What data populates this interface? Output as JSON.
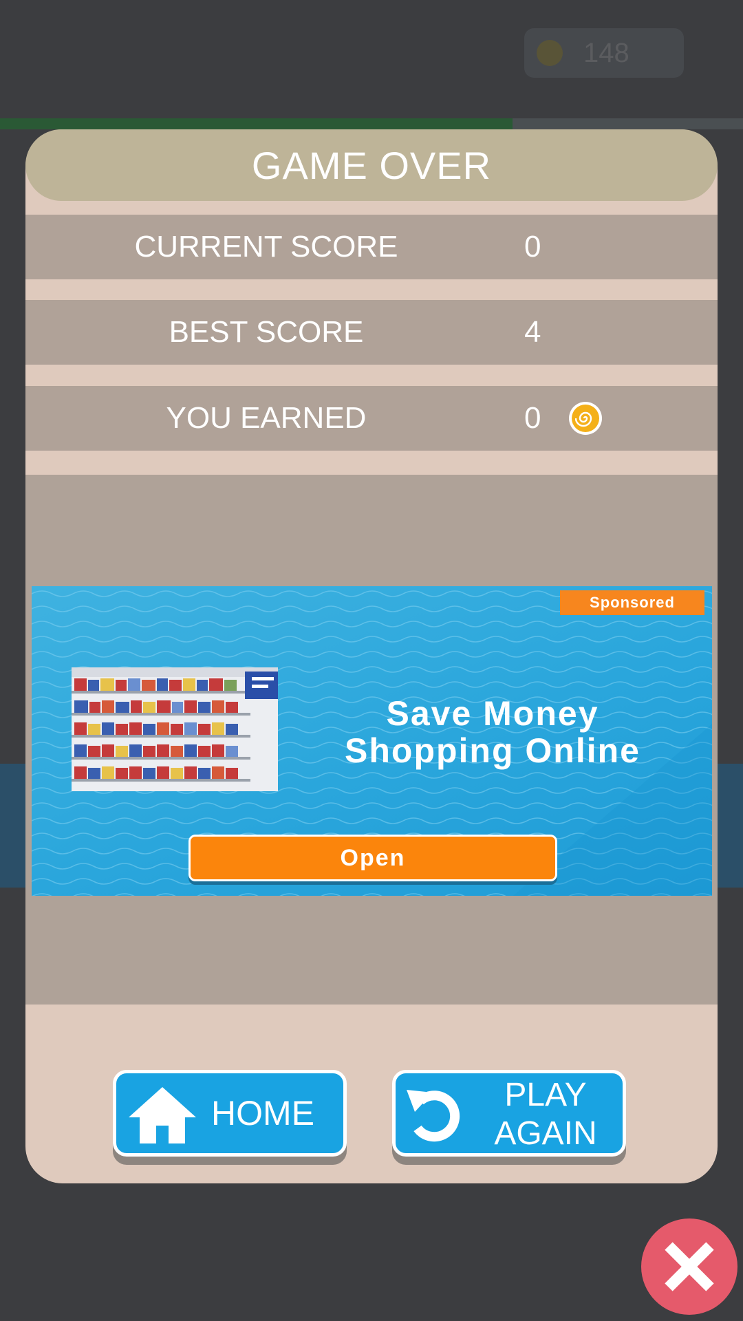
{
  "hud": {
    "coins": "148",
    "level_progress": 0.69
  },
  "dialog": {
    "title": "GAME OVER",
    "rows": [
      {
        "label": "CURRENT SCORE",
        "value": "0"
      },
      {
        "label": "BEST SCORE",
        "value": "4"
      },
      {
        "label": "YOU EARNED",
        "value": "0",
        "icon": "coin-icon"
      }
    ]
  },
  "ad": {
    "badge": "Sponsored",
    "headline_line1": "Save Money",
    "headline_line2": "Shopping Online",
    "cta": "Open"
  },
  "buttons": {
    "home": "HOME",
    "play_again_line1": "PLAY",
    "play_again_line2": "AGAIN"
  },
  "colors": {
    "background": "#3c3d40",
    "dialog": "#dfcabd",
    "title_bar": "#beb498",
    "score_row": "#b0a298",
    "button_blue": "#19a3e2",
    "ad_blue": "#2aa6dc",
    "ad_orange": "#fb850c",
    "close_red": "#e55a6b",
    "coin_gold": "#f4b019"
  }
}
